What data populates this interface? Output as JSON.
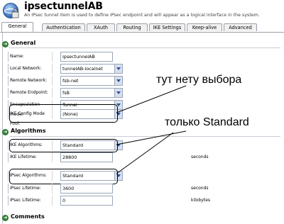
{
  "header": {
    "title": "ipsectunnelAB",
    "subtitle": "An IPsec tunnel item is used to define IPsec endpoint and will appear as a logical interface in the system."
  },
  "tabs": [
    {
      "label": "General"
    },
    {
      "label": "Authentication"
    },
    {
      "label": "XAuth"
    },
    {
      "label": "Routing"
    },
    {
      "label": "IKE Settings"
    },
    {
      "label": "Keep-alive"
    },
    {
      "label": "Advanced"
    }
  ],
  "active_tab": "General",
  "sections": {
    "general": "General",
    "algorithms": "Algorithms",
    "comments": "Comments"
  },
  "general": {
    "name": {
      "label": "Name:",
      "value": "ipsectunnelAB"
    },
    "local_network": {
      "label": "Local Network:",
      "value": "tunnelAB-localnet"
    },
    "remote_network": {
      "label": "Remote Network:",
      "value": "fsb-net"
    },
    "remote_endpoint": {
      "label": "Remote Endpoint:",
      "value": "fsB"
    },
    "encapsulation_mode": {
      "label": "Encapsulation mode:",
      "value": "Tunnel"
    },
    "ike_config_pool": {
      "label": "IKE Config Mode Pool:",
      "value": "(None)"
    }
  },
  "algorithms": {
    "ike_algorithms": {
      "label": "IKE Algorithms:",
      "value": "Standard"
    },
    "ike_lifetime": {
      "label": "IKE Lifetime:",
      "value": "28800",
      "unit": "seconds"
    },
    "ipsec_algorithms": {
      "label": "IPsec Algorithms:",
      "value": "Standard"
    },
    "ipsec_lifetime": {
      "label": "IPsec Lifetime:",
      "value": "3600",
      "unit": "seconds"
    },
    "ipsec_lifetime_kb": {
      "label": "IPsec Lifetime:",
      "value": "0",
      "unit": "kilobytes"
    }
  },
  "annotations": {
    "no_choice": "тут нету выбора",
    "only_standard": "только Standard"
  },
  "colors": {
    "accent": "#2f4f8f",
    "section_icon": "#2e7d32",
    "border": "#9aa6b8"
  }
}
